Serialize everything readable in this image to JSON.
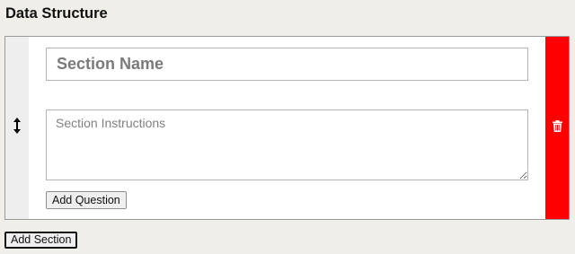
{
  "page": {
    "title": "Data Structure"
  },
  "section": {
    "name_placeholder": "Section Name",
    "name_value": "",
    "instructions_placeholder": "Section Instructions",
    "instructions_value": "",
    "add_question_label": "Add Question",
    "drag_icon": "vertical-resize-arrow-icon",
    "delete_icon": "trash-icon",
    "delete_color": "#ff0000"
  },
  "footer": {
    "add_section_label": "Add Section"
  }
}
